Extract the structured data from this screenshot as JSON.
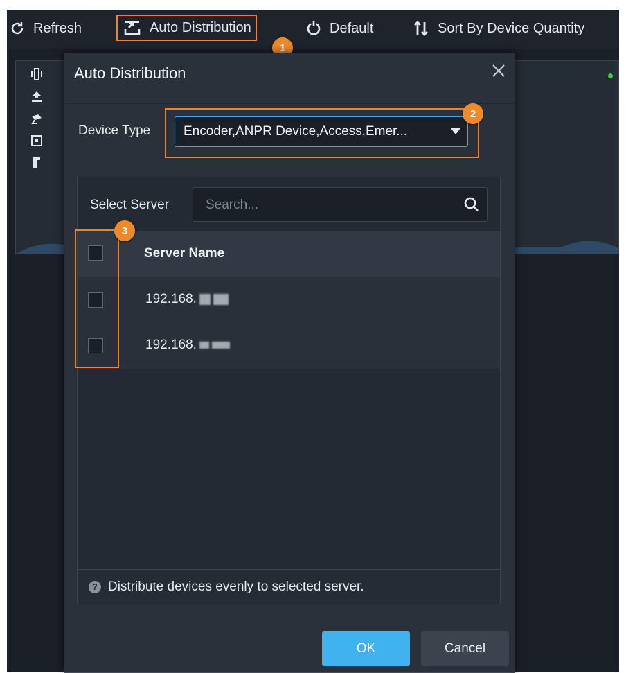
{
  "toolbar": {
    "refresh_label": "Refresh",
    "auto_distribution_label": "Auto Distribution",
    "default_label": "Default",
    "sort_label": "Sort By Device Quantity"
  },
  "annotations": {
    "step1": "1",
    "step2": "2",
    "step3": "3"
  },
  "dialog": {
    "title": "Auto Distribution",
    "device_type_label": "Device Type",
    "device_type_value": "Encoder,ANPR Device,Access,Emer...",
    "select_server_label": "Select Server",
    "search_placeholder": "Search...",
    "column_server_name": "Server Name",
    "servers": [
      {
        "ip": "192.168."
      },
      {
        "ip": "192.168."
      }
    ],
    "tip": "Distribute devices evenly to selected server.",
    "tip_icon": "?",
    "ok_label": "OK",
    "cancel_label": "Cancel"
  },
  "colors": {
    "accent": "#41b2f0",
    "highlight": "#f0822a",
    "status_online": "#39d339"
  },
  "icons": [
    "refresh-icon",
    "auto-distribution-icon",
    "default-icon",
    "sort-icon",
    "close-icon",
    "search-icon",
    "help-icon"
  ]
}
